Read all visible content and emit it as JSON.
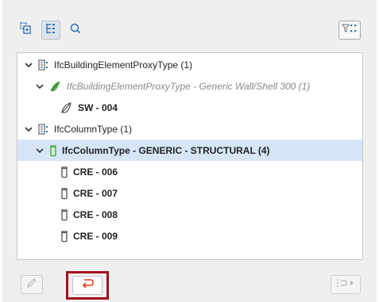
{
  "toolbar": {
    "buttons": [
      {
        "icon": "add-to-selection-icon"
      },
      {
        "icon": "tree-view-icon",
        "active": true
      },
      {
        "icon": "find-icon"
      }
    ],
    "filter_icon": "filter-icon"
  },
  "tree": {
    "items": [
      {
        "label": "IfcBuildingElementProxyType (1)",
        "icon": "type-list-icon"
      },
      {
        "label": "IfcBuildingElementProxyType - Generic Wall/Shell 300 (1)",
        "icon": "shell-icon"
      },
      {
        "label": "SW - 004",
        "icon": "shell-icon"
      },
      {
        "label": "IfcColumnType (1)",
        "icon": "type-list-icon"
      },
      {
        "label": "IfcColumnType - GENERIC - STRUCTURAL  (4)",
        "icon": "column-icon"
      },
      {
        "label": "CRE - 006",
        "icon": "column-icon"
      },
      {
        "label": "CRE - 007",
        "icon": "column-icon"
      },
      {
        "label": "CRE - 008",
        "icon": "column-icon"
      },
      {
        "label": "CRE - 009",
        "icon": "column-icon"
      }
    ]
  },
  "bottom": {
    "edit_icon": "pencil-icon",
    "unlink_icon": "unlink-return-icon",
    "nav_icon": "step-forward-icon"
  },
  "colors": {
    "accent": "#e23b1a",
    "selection": "#d6e6f7",
    "highlight_border": "#a50f1c",
    "icon_blue": "#2d6fb6",
    "shell_green": "#3aa637"
  }
}
